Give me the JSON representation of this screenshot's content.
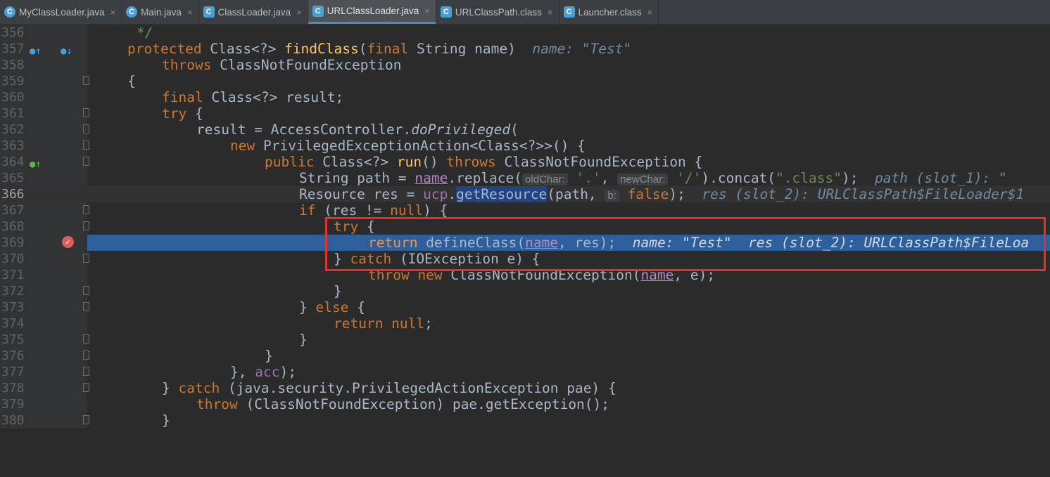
{
  "tabs": [
    {
      "label": "MyClassLoader.java",
      "icon": "class-icon",
      "active": false
    },
    {
      "label": "Main.java",
      "icon": "class-icon",
      "active": false
    },
    {
      "label": "ClassLoader.java",
      "icon": "class-icon",
      "active": false
    },
    {
      "label": "URLClassLoader.java",
      "icon": "class-icon",
      "active": true
    },
    {
      "label": "URLClassPath.class",
      "icon": "class-icon",
      "active": false
    },
    {
      "label": "Launcher.class",
      "icon": "class-icon",
      "active": false
    }
  ],
  "tab_close_glyph": "×",
  "lines": {
    "l356": "356",
    "l357": "357",
    "l358": "358",
    "l359": "359",
    "l360": "360",
    "l361": "361",
    "l362": "362",
    "l363": "363",
    "l364": "364",
    "l365": "365",
    "l366": "366",
    "l367": "367",
    "l368": "368",
    "l369": "369",
    "l370": "370",
    "l371": "371",
    "l372": "372",
    "l373": "373",
    "l374": "374",
    "l375": "375",
    "l376": "376",
    "l377": "377",
    "l378": "378",
    "l379": "379",
    "l380": "380"
  },
  "code": {
    "c356_a": "*/",
    "c357_kw": "protected ",
    "c357_a": "Class<?> ",
    "c357_fn": "findClass",
    "c357_b": "(",
    "c357_kw2": "final ",
    "c357_c": "String name)",
    "c357_hint": "name: \"Test\"",
    "c358_kw": "throws ",
    "c358_a": "ClassNotFoundException",
    "c359_a": "{",
    "c360_kw": "final ",
    "c360_a": "Class<?> result;",
    "c361_kw": "try ",
    "c361_a": "{",
    "c362_a": "result = AccessController.",
    "c362_it": "doPrivileged",
    "c362_b": "(",
    "c363_kw": "new ",
    "c363_a": "PrivilegedExceptionAction<Class<?>>() {",
    "c364_kw": "public ",
    "c364_a": "Class<?> ",
    "c364_fn": "run",
    "c364_b": "() ",
    "c364_kw2": "throws ",
    "c364_c": "ClassNotFoundException {",
    "c365_a": "String path = ",
    "c365_pu": "name",
    "c365_b": ".replace(",
    "c365_p1": "oldChar:",
    "c365_s1": "'.'",
    "c365_c": ", ",
    "c365_p2": "newChar:",
    "c365_s2": "'/'",
    "c365_d": ").concat(",
    "c365_s3": "\".class\"",
    "c365_e": ");",
    "c365_hint": "path (slot_1): \"",
    "c366_a": "Resource res = ",
    "c366_fld": "ucp",
    "c366_b": ".",
    "c366_hl": "getResource",
    "c366_c": "(path, ",
    "c366_p": "b:",
    "c366_kw": "false",
    "c366_d": ");",
    "c366_hint": "res (slot_2): URLClassPath$FileLoader$1",
    "c367_kw": "if ",
    "c367_a": "(res != ",
    "c367_kw2": "null",
    "c367_b": ") {",
    "c368_kw": "try ",
    "c368_a": "{",
    "c369_kw": "return ",
    "c369_a": "defineClass(",
    "c369_pu": "name",
    "c369_b": ", res);",
    "c369_hint": "name: \"Test\"  res (slot_2): URLClassPath$FileLoa",
    "c370_a": "} ",
    "c370_kw": "catch ",
    "c370_b": "(IOException e) {",
    "c371_kw": "throw new ",
    "c371_a": "ClassNotFoundException(",
    "c371_pu": "name",
    "c371_b": ", e);",
    "c372_a": "}",
    "c373_a": "} ",
    "c373_kw": "else ",
    "c373_b": "{",
    "c374_kw": "return null",
    "c374_a": ";",
    "c375_a": "}",
    "c376_a": "}",
    "c377_a": "}, ",
    "c377_fld": "acc",
    "c377_b": ");",
    "c378_a": "} ",
    "c378_kw": "catch ",
    "c378_b": "(java.security.PrivilegedActionException pae) {",
    "c379_kw": "throw ",
    "c379_a": "(ClassNotFoundException) pae.getException();",
    "c380_a": "}"
  },
  "colors": {
    "background": "#2b2b2b",
    "selection": "#2d5f9c",
    "keyword": "#cc7832",
    "method": "#ffc66d",
    "string": "#6a8759",
    "highlight_box": "#e0322b"
  }
}
